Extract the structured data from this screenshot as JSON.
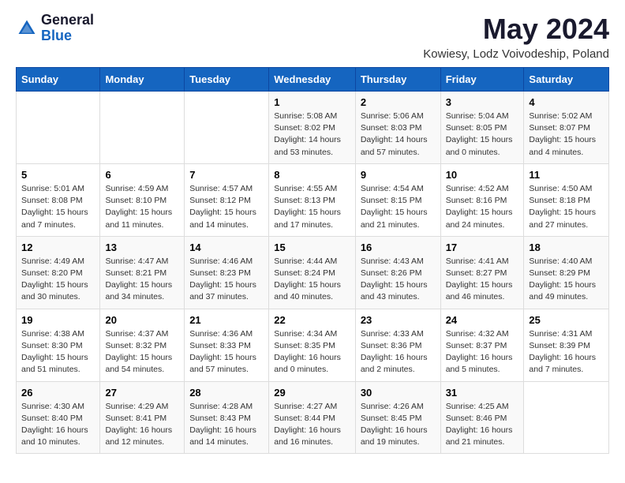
{
  "header": {
    "logo_general": "General",
    "logo_blue": "Blue",
    "title": "May 2024",
    "subtitle": "Kowiesy, Lodz Voivodeship, Poland"
  },
  "days_of_week": [
    "Sunday",
    "Monday",
    "Tuesday",
    "Wednesday",
    "Thursday",
    "Friday",
    "Saturday"
  ],
  "weeks": [
    [
      {
        "day": "",
        "info": ""
      },
      {
        "day": "",
        "info": ""
      },
      {
        "day": "",
        "info": ""
      },
      {
        "day": "1",
        "info": "Sunrise: 5:08 AM\nSunset: 8:02 PM\nDaylight: 14 hours\nand 53 minutes."
      },
      {
        "day": "2",
        "info": "Sunrise: 5:06 AM\nSunset: 8:03 PM\nDaylight: 14 hours\nand 57 minutes."
      },
      {
        "day": "3",
        "info": "Sunrise: 5:04 AM\nSunset: 8:05 PM\nDaylight: 15 hours\nand 0 minutes."
      },
      {
        "day": "4",
        "info": "Sunrise: 5:02 AM\nSunset: 8:07 PM\nDaylight: 15 hours\nand 4 minutes."
      }
    ],
    [
      {
        "day": "5",
        "info": "Sunrise: 5:01 AM\nSunset: 8:08 PM\nDaylight: 15 hours\nand 7 minutes."
      },
      {
        "day": "6",
        "info": "Sunrise: 4:59 AM\nSunset: 8:10 PM\nDaylight: 15 hours\nand 11 minutes."
      },
      {
        "day": "7",
        "info": "Sunrise: 4:57 AM\nSunset: 8:12 PM\nDaylight: 15 hours\nand 14 minutes."
      },
      {
        "day": "8",
        "info": "Sunrise: 4:55 AM\nSunset: 8:13 PM\nDaylight: 15 hours\nand 17 minutes."
      },
      {
        "day": "9",
        "info": "Sunrise: 4:54 AM\nSunset: 8:15 PM\nDaylight: 15 hours\nand 21 minutes."
      },
      {
        "day": "10",
        "info": "Sunrise: 4:52 AM\nSunset: 8:16 PM\nDaylight: 15 hours\nand 24 minutes."
      },
      {
        "day": "11",
        "info": "Sunrise: 4:50 AM\nSunset: 8:18 PM\nDaylight: 15 hours\nand 27 minutes."
      }
    ],
    [
      {
        "day": "12",
        "info": "Sunrise: 4:49 AM\nSunset: 8:20 PM\nDaylight: 15 hours\nand 30 minutes."
      },
      {
        "day": "13",
        "info": "Sunrise: 4:47 AM\nSunset: 8:21 PM\nDaylight: 15 hours\nand 34 minutes."
      },
      {
        "day": "14",
        "info": "Sunrise: 4:46 AM\nSunset: 8:23 PM\nDaylight: 15 hours\nand 37 minutes."
      },
      {
        "day": "15",
        "info": "Sunrise: 4:44 AM\nSunset: 8:24 PM\nDaylight: 15 hours\nand 40 minutes."
      },
      {
        "day": "16",
        "info": "Sunrise: 4:43 AM\nSunset: 8:26 PM\nDaylight: 15 hours\nand 43 minutes."
      },
      {
        "day": "17",
        "info": "Sunrise: 4:41 AM\nSunset: 8:27 PM\nDaylight: 15 hours\nand 46 minutes."
      },
      {
        "day": "18",
        "info": "Sunrise: 4:40 AM\nSunset: 8:29 PM\nDaylight: 15 hours\nand 49 minutes."
      }
    ],
    [
      {
        "day": "19",
        "info": "Sunrise: 4:38 AM\nSunset: 8:30 PM\nDaylight: 15 hours\nand 51 minutes."
      },
      {
        "day": "20",
        "info": "Sunrise: 4:37 AM\nSunset: 8:32 PM\nDaylight: 15 hours\nand 54 minutes."
      },
      {
        "day": "21",
        "info": "Sunrise: 4:36 AM\nSunset: 8:33 PM\nDaylight: 15 hours\nand 57 minutes."
      },
      {
        "day": "22",
        "info": "Sunrise: 4:34 AM\nSunset: 8:35 PM\nDaylight: 16 hours\nand 0 minutes."
      },
      {
        "day": "23",
        "info": "Sunrise: 4:33 AM\nSunset: 8:36 PM\nDaylight: 16 hours\nand 2 minutes."
      },
      {
        "day": "24",
        "info": "Sunrise: 4:32 AM\nSunset: 8:37 PM\nDaylight: 16 hours\nand 5 minutes."
      },
      {
        "day": "25",
        "info": "Sunrise: 4:31 AM\nSunset: 8:39 PM\nDaylight: 16 hours\nand 7 minutes."
      }
    ],
    [
      {
        "day": "26",
        "info": "Sunrise: 4:30 AM\nSunset: 8:40 PM\nDaylight: 16 hours\nand 10 minutes."
      },
      {
        "day": "27",
        "info": "Sunrise: 4:29 AM\nSunset: 8:41 PM\nDaylight: 16 hours\nand 12 minutes."
      },
      {
        "day": "28",
        "info": "Sunrise: 4:28 AM\nSunset: 8:43 PM\nDaylight: 16 hours\nand 14 minutes."
      },
      {
        "day": "29",
        "info": "Sunrise: 4:27 AM\nSunset: 8:44 PM\nDaylight: 16 hours\nand 16 minutes."
      },
      {
        "day": "30",
        "info": "Sunrise: 4:26 AM\nSunset: 8:45 PM\nDaylight: 16 hours\nand 19 minutes."
      },
      {
        "day": "31",
        "info": "Sunrise: 4:25 AM\nSunset: 8:46 PM\nDaylight: 16 hours\nand 21 minutes."
      },
      {
        "day": "",
        "info": ""
      }
    ]
  ]
}
